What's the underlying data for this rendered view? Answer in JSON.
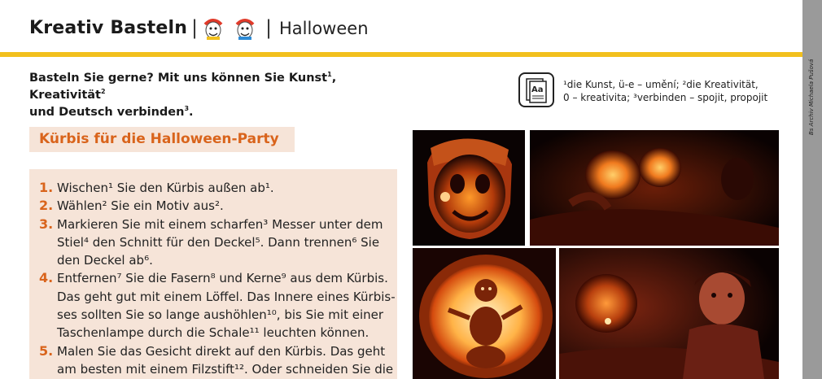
{
  "header": {
    "title": "Kreativ Basteln",
    "separator": "|",
    "section": "Halloween"
  },
  "credit": "Bs Archiv Michaela Pušová",
  "intro": {
    "part1": "Basteln Sie gerne? Mit uns können Sie Kunst",
    "sup1": "1",
    "part2": ", Kreativität",
    "sup2": "2",
    "part3": "und Deutsch verbinden",
    "sup3": "3",
    "part4": "."
  },
  "glossary": {
    "icon_text": "Aa",
    "line1": "¹die Kunst, ü-e – umění; ²die Kreativität,",
    "line2": "0 – kreativita; ³verbinden – spojit, propojit"
  },
  "section_heading": "Kürbis für die Halloween-Party",
  "steps": [
    {
      "num": "1.",
      "lines": [
        "Wischen¹ Sie den Kürbis außen ab¹."
      ]
    },
    {
      "num": "2.",
      "lines": [
        "Wählen² Sie ein Motiv aus²."
      ]
    },
    {
      "num": "3.",
      "lines": [
        "Markieren Sie mit einem scharfen³ Messer unter dem",
        "Stiel⁴ den Schnitt für den Deckel⁵. Dann trennen⁶ Sie",
        "den Deckel ab⁶."
      ]
    },
    {
      "num": "4.",
      "lines": [
        "Entfernen⁷ Sie die Fasern⁸ und Kerne⁹ aus dem Kürbis.",
        "Das geht gut mit einem Löffel. Das Innere eines Kürbis-",
        "ses sollten Sie so lange aushöhlen¹⁰, bis Sie mit einer",
        "Taschenlampe durch die Schale¹¹ leuchten können."
      ]
    },
    {
      "num": "5.",
      "lines": [
        "Malen Sie das Gesicht direkt auf den Kürbis. Das geht",
        "am besten mit einem Filzstift¹². Oder schneiden Sie die"
      ]
    }
  ],
  "colors": {
    "accent_orange": "#d9641c",
    "header_rule": "#f2c01d",
    "panel_bg": "#f6e4d8",
    "side_strip": "#9a9a9a"
  }
}
